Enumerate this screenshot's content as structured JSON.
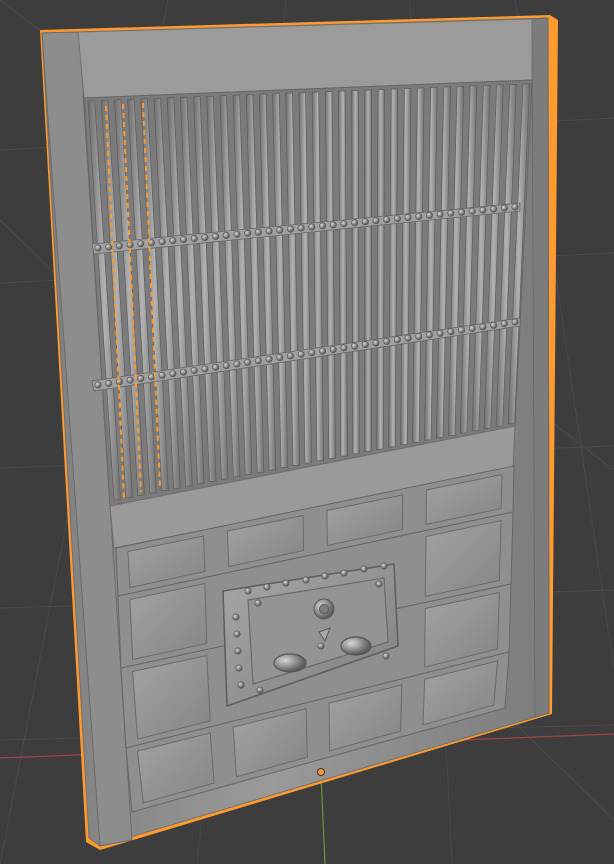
{
  "viewport": {
    "mode": "solid",
    "background": "#3d3d3d",
    "grid_color": "#474747",
    "x_axis_color": "#a1434b",
    "y_axis_color": "#6a9434"
  },
  "object": {
    "name": "door",
    "selected": true,
    "selection_outline_color": "#ff9a2e",
    "base_color": "#8e8e8e",
    "origin_color": "#ff9a2e",
    "rows": {
      "top_vertical_bars": 34,
      "lower_panels": 4,
      "panel_columns": 4
    }
  }
}
